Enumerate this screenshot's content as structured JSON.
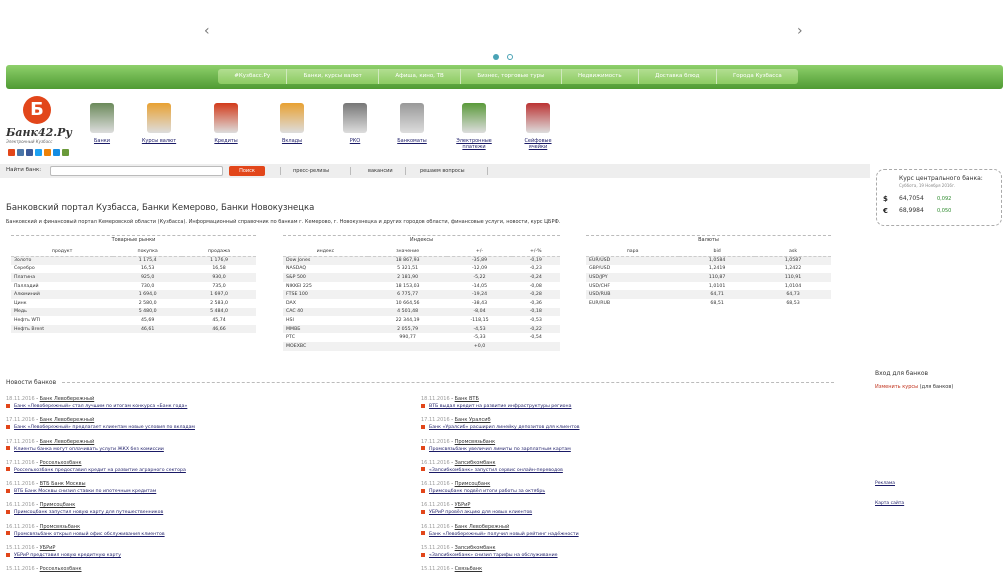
{
  "slider": {
    "prev_icon": "chevron-left-icon",
    "next_icon": "chevron-right-icon",
    "prev_glyph": "‹",
    "next_glyph": "›"
  },
  "topnav": {
    "tabs": [
      "#Кузбасс.Ру",
      "Банки, курсы валют",
      "Афиша, кино, ТВ",
      "Бизнес, торговые туры",
      "Недвижимость",
      "Доставка блюд",
      "Города Кузбасса"
    ]
  },
  "logo": {
    "mark": "Б",
    "text": "Банк42.Ру",
    "sub": "Электронный Кузбасс"
  },
  "services": [
    {
      "label": "Банки",
      "icon": "bank-building-icon"
    },
    {
      "label": "Курсы валют",
      "icon": "currency-icon"
    },
    {
      "label": "Кредиты",
      "icon": "credit-hourglass-icon"
    },
    {
      "label": "Вклады",
      "icon": "deposit-coins-icon"
    },
    {
      "label": "РКО",
      "icon": "cash-register-icon"
    },
    {
      "label": "Банкоматы",
      "icon": "atm-icon"
    },
    {
      "label": "Электронные платежи",
      "icon": "e-payments-icon"
    },
    {
      "label": "Сейфовые ячейки",
      "icon": "safe-icon"
    }
  ],
  "search": {
    "label": "Найти банк:",
    "placeholder": "",
    "button": "Поиск",
    "links": [
      "пресс-релизы",
      "вакансии",
      "решаем вопросы"
    ]
  },
  "cbr": {
    "title": "Курс центрального банка:",
    "date": "Суббота, 19 Ноября 2016г.",
    "rates": [
      {
        "symbol": "$",
        "value": "64,7054",
        "change": "0,092"
      },
      {
        "symbol": "€",
        "value": "68,9984",
        "change": "0,050"
      }
    ]
  },
  "portal": {
    "title": "Банковский портал Кузбасса, Банки Кемерово, Банки Новокузнецка",
    "description": "Банковский и финансовый портал Кемеровской области (Кузбасса). Информационный справочник по банкам г. Кемерово, г. Новокузнецка и других городов области, финансовые услуги, новости, курс ЦБРФ."
  },
  "commodities": {
    "title": "Товарные рынки",
    "headers": [
      "продукт",
      "покупка",
      "продажа"
    ],
    "rows": [
      [
        "Золото",
        "1 175,4",
        "1 176,9"
      ],
      [
        "Серебро",
        "16,53",
        "16,58"
      ],
      [
        "Платина",
        "925,0",
        "930,0"
      ],
      [
        "Палладий",
        "730,0",
        "735,0"
      ],
      [
        "Алюминий",
        "1 694,0",
        "1 697,0"
      ],
      [
        "Цинк",
        "2 580,0",
        "2 583,0"
      ],
      [
        "Медь",
        "5 480,0",
        "5 484,0"
      ],
      [
        "Нефть WTI",
        "45,69",
        "45,74"
      ],
      [
        "Нефть Brent",
        "46,61",
        "46,66"
      ]
    ]
  },
  "indices": {
    "title": "Индексы",
    "headers": [
      "индекс",
      "значение",
      "+/-",
      "+/-%"
    ],
    "rows": [
      [
        "Dow Jones",
        "18 867,93",
        "-35,89",
        "-0,19"
      ],
      [
        "NASDAQ",
        "5 321,51",
        "-12,09",
        "-0,23"
      ],
      [
        "S&P 500",
        "2 181,90",
        "-5,22",
        "-0,24"
      ],
      [
        "NIKKEI 225",
        "18 153,03",
        "-14,05",
        "-0,08"
      ],
      [
        "FTSE 100",
        "6 775,77",
        "-19,24",
        "-0,28"
      ],
      [
        "DAX",
        "10 664,56",
        "-38,43",
        "-0,36"
      ],
      [
        "CAC 40",
        "4 501,48",
        "-8,04",
        "-0,18"
      ],
      [
        "HSI",
        "22 344,19",
        "-118,15",
        "-0,53"
      ],
      [
        "ММВБ",
        "2 055,79",
        "-4,53",
        "-0,22"
      ],
      [
        "РТС",
        "990,77",
        "-5,33",
        "-0,54"
      ],
      [
        "MOEXBC",
        "",
        "+0,0",
        ""
      ]
    ]
  },
  "currencies": {
    "title": "Валюты",
    "headers": [
      "пара",
      "bid",
      "ask"
    ],
    "rows": [
      [
        "EUR/USD",
        "1,0584",
        "1,0587"
      ],
      [
        "GBP/USD",
        "1,2419",
        "1,2422"
      ],
      [
        "USD/JPY",
        "110,87",
        "110,91"
      ],
      [
        "USD/CHF",
        "1,0101",
        "1,0104"
      ],
      [
        "USD/RUB",
        "64,71",
        "64,73"
      ],
      [
        "EUR/RUB",
        "68,51",
        "68,53"
      ]
    ]
  },
  "news": {
    "heading": "Новости банков",
    "left": [
      {
        "date": "18.11.2016",
        "src": "Банк Левобережный",
        "title": "Банк «Левобережный» стал лучшим по итогам конкурса «Банк года»"
      },
      {
        "date": "17.11.2016",
        "src": "Банк Левобережный",
        "title": "Банк «Левобережный» предлагает клиентам новые условия по вкладам"
      },
      {
        "date": "17.11.2016",
        "src": "Банк Левобережный",
        "title": "Клиенты банка могут оплачивать услуги ЖКХ без комиссии"
      },
      {
        "date": "17.11.2016",
        "src": "Россельхозбанк",
        "title": "Россельхозбанк предоставил кредит на развитие аграрного сектора"
      },
      {
        "date": "16.11.2016",
        "src": "ВТБ Банк Москвы",
        "title": "ВТБ Банк Москвы снизил ставки по ипотечным кредитам"
      },
      {
        "date": "16.11.2016",
        "src": "Примсоцбанк",
        "title": "Примсоцбанк запустил новую карту для путешественников"
      },
      {
        "date": "16.11.2016",
        "src": "Промсвязьбанк",
        "title": "Промсвязьбанк открыл новый офис обслуживания клиентов"
      },
      {
        "date": "15.11.2016",
        "src": "УБРиР",
        "title": "УБРиР представил новую кредитную карту"
      },
      {
        "date": "15.11.2016",
        "src": "Россельхозбанк",
        "title": ""
      }
    ],
    "right": [
      {
        "date": "18.11.2016",
        "src": "Банк ВТБ",
        "title": "ВТБ выдал кредит на развитие инфраструктуры региона"
      },
      {
        "date": "17.11.2016",
        "src": "Банк Уралсиб",
        "title": "Банк «Уралсиб» расширил линейку депозитов для клиентов"
      },
      {
        "date": "17.11.2016",
        "src": "Промсвязьбанк",
        "title": "Промсвязьбанк увеличил лимиты по зарплатным картам"
      },
      {
        "date": "16.11.2016",
        "src": "Запсибкомбанк",
        "title": "«Запсибкомбанк» запустил сервис онлайн-переводов"
      },
      {
        "date": "16.11.2016",
        "src": "Примсоцбанк",
        "title": "Примсоцбанк подвёл итоги работы за октябрь"
      },
      {
        "date": "16.11.2016",
        "src": "УБРиР",
        "title": "УБРиР провёл акцию для новых клиентов"
      },
      {
        "date": "16.11.2016",
        "src": "Банк Левобережный",
        "title": "Банк «Левобережный» получил новый рейтинг надёжности"
      },
      {
        "date": "15.11.2016",
        "src": "Запсибкомбанк",
        "title": "«Запсибкомбанк» снизил тарифы на обслуживание"
      },
      {
        "date": "15.11.2016",
        "src": "Связьбанк",
        "title": ""
      }
    ]
  },
  "sidebar": {
    "login_title": "Вход для банков",
    "change_rates": "Изменить курсы",
    "change_rates_note": "(для банков)",
    "links": [
      "Реклама",
      "Карта сайта"
    ]
  }
}
